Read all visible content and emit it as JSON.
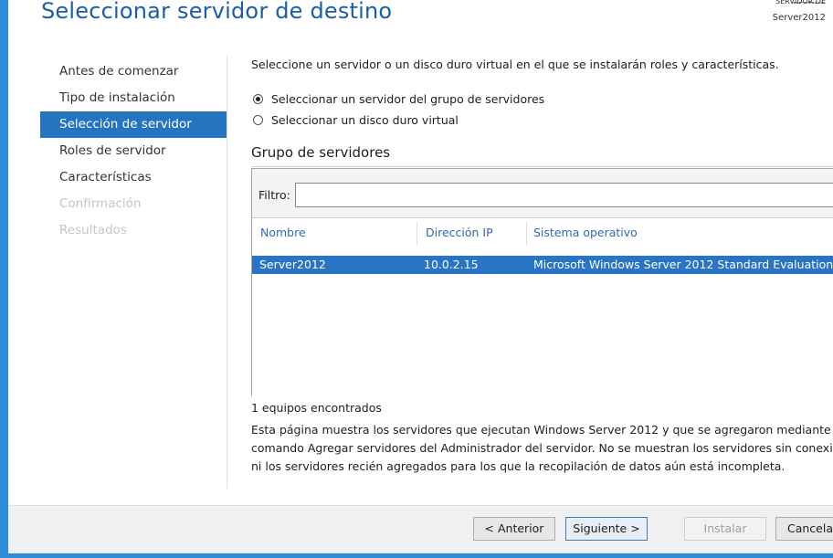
{
  "header": {
    "title": "Seleccionar servidor de destino",
    "destination_server_label": "SERVIDOR DE DESTINO",
    "destination_server": "Server2012"
  },
  "nav": {
    "items": [
      {
        "label": "Antes de comenzar",
        "state": "normal"
      },
      {
        "label": "Tipo de instalación",
        "state": "normal"
      },
      {
        "label": "Selección de servidor",
        "state": "selected"
      },
      {
        "label": "Roles de servidor",
        "state": "normal"
      },
      {
        "label": "Características",
        "state": "normal"
      },
      {
        "label": "Confirmación",
        "state": "disabled"
      },
      {
        "label": "Resultados",
        "state": "disabled"
      }
    ]
  },
  "main": {
    "instruction": "Seleccione un servidor o un disco duro virtual en el que se instalarán roles y características.",
    "options": [
      {
        "label": "Seleccionar un servidor del grupo de servidores",
        "checked": true
      },
      {
        "label": "Seleccionar un disco duro virtual",
        "checked": false
      }
    ],
    "group_title": "Grupo de servidores",
    "filter": {
      "label": "Filtro:",
      "value": "",
      "placeholder": ""
    },
    "table": {
      "columns": [
        "Nombre",
        "Dirección IP",
        "Sistema operativo"
      ],
      "rows": [
        {
          "name": "Server2012",
          "ip": "10.0.2.15",
          "os": "Microsoft Windows Server 2012 Standard Evaluation",
          "selected": true
        }
      ]
    },
    "found_count": "1 equipos encontrados",
    "description": [
      "Esta página muestra los servidores que ejecutan Windows Server 2012 y que se agregaron mediante el",
      "comando Agregar servidores del Administrador del servidor. No se muestran los servidores sin conexión",
      "ni los servidores recién agregados para los que la recopilación de datos aún está incompleta."
    ]
  },
  "footer": {
    "prev_label": "< Anterior",
    "next_label": "Siguiente >",
    "install_label": "Instalar",
    "cancel_label": "Cancelar"
  },
  "colors": {
    "accent": "#2b8dd8",
    "title": "#1b5ea6",
    "selected_nav": "#2674c0",
    "selected_row": "#2a74c6",
    "column_header": "#2f6bb2",
    "disabled_nav": "#c6c6c6"
  }
}
